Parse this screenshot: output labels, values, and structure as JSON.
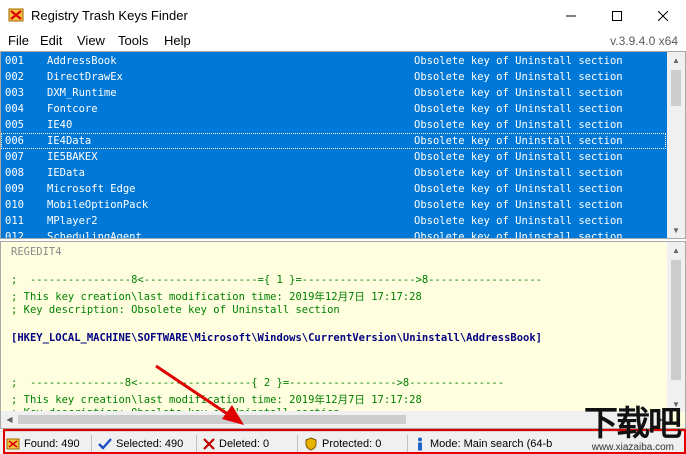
{
  "window": {
    "title": "Registry Trash Keys Finder",
    "version": "v.3.9.4.0 x64"
  },
  "menu": [
    "File",
    "Edit",
    "View",
    "Tools",
    "Help"
  ],
  "keylist": {
    "rows": [
      {
        "num": "001",
        "name": "AddressBook",
        "desc": "Obsolete key of Uninstall section"
      },
      {
        "num": "002",
        "name": "DirectDrawEx",
        "desc": "Obsolete key of Uninstall section"
      },
      {
        "num": "003",
        "name": "DXM_Runtime",
        "desc": "Obsolete key of Uninstall section"
      },
      {
        "num": "004",
        "name": "Fontcore",
        "desc": "Obsolete key of Uninstall section"
      },
      {
        "num": "005",
        "name": "IE40",
        "desc": "Obsolete key of Uninstall section"
      },
      {
        "num": "006",
        "name": "IE4Data",
        "desc": "Obsolete key of Uninstall section"
      },
      {
        "num": "007",
        "name": "IE5BAKEX",
        "desc": "Obsolete key of Uninstall section"
      },
      {
        "num": "008",
        "name": "IEData",
        "desc": "Obsolete key of Uninstall section"
      },
      {
        "num": "009",
        "name": "Microsoft Edge",
        "desc": "Obsolete key of Uninstall section"
      },
      {
        "num": "010",
        "name": "MobileOptionPack",
        "desc": "Obsolete key of Uninstall section"
      },
      {
        "num": "011",
        "name": "MPlayer2",
        "desc": "Obsolete key of Uninstall section"
      },
      {
        "num": "012",
        "name": "SchedulingAgent",
        "desc": "Obsolete key of Uninstall section"
      }
    ]
  },
  "detail": {
    "header": "REGEDIT4",
    "sep1": ";  ----------------8<------------------={ 1 }=------------------>8------------------",
    "time1": "; This key creation\\last modification time: 2019年12月7日 17:17:28",
    "desc1": "; Key description: Obsolete key of Uninstall section",
    "path1": "[HKEY_LOCAL_MACHINE\\SOFTWARE\\Microsoft\\Windows\\CurrentVersion\\Uninstall\\AddressBook]",
    "sep2": ";  ---------------8<------------------{ 2 }=----------------->8---------------",
    "time2": "; This key creation\\last modification time: 2019年12月7日 17:17:28",
    "desc2": "; Key description: Obsolete key of Uninstall section"
  },
  "status": {
    "found": "Found: 490",
    "selected": "Selected: 490",
    "deleted": "Deleted: 0",
    "protected": "Protected: 0",
    "mode": "Mode: Main search (64-b"
  },
  "watermark": {
    "logo": "下载吧",
    "url": "www.xiazaiba.com"
  },
  "colors": {
    "selection": "#0078d7",
    "detail_bg": "#ffffe0",
    "highlight": "#e00000"
  }
}
